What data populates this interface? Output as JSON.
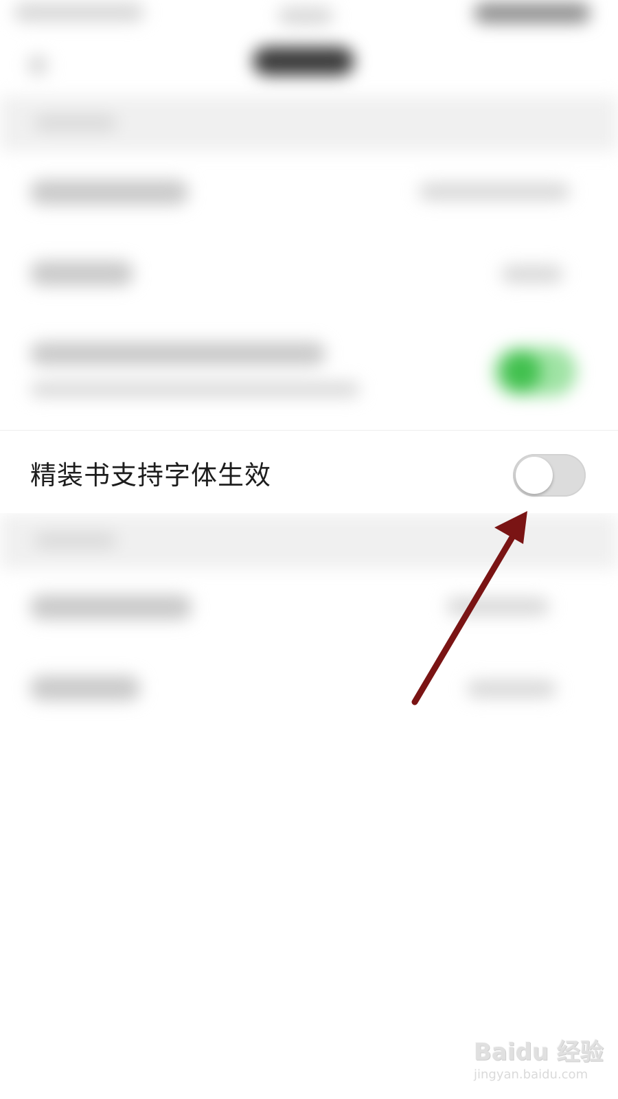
{
  "settings_row": {
    "label": "精装书支持字体生效",
    "toggle_state": "off"
  },
  "annotation": {
    "arrow_color": "#7a1414",
    "target": "toggle"
  },
  "colors": {
    "toggle_on_green": "#41c04e",
    "toggle_off_track": "#dcdcdc",
    "background": "#ffffff"
  },
  "watermark": {
    "brand": "Baidu 经验",
    "url": "jingyan.baidu.com"
  }
}
